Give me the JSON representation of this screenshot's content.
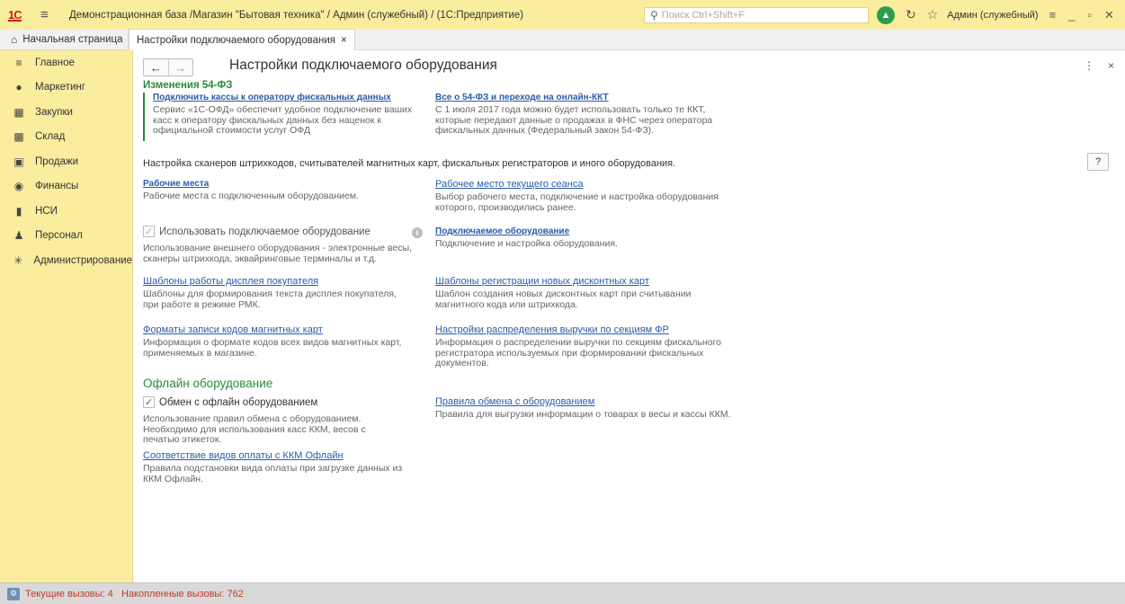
{
  "window": {
    "logo": "1С",
    "title": "Демонстрационная база /Магазин \"Бытовая техника\" / Админ (служебный) /  (1С:Предприятие)",
    "search_placeholder": "Поиск Ctrl+Shift+F",
    "user": "Админ (служебный)"
  },
  "tabs": {
    "home": "Начальная страница",
    "active": "Настройки подключаемого оборудования",
    "close_glyph": "×"
  },
  "sidebar": {
    "items": [
      {
        "label": "Главное",
        "icon": "menu-lines-icon"
      },
      {
        "label": "Маркетинг",
        "icon": "marketing-icon"
      },
      {
        "label": "Закупки",
        "icon": "purchases-icon"
      },
      {
        "label": "Склад",
        "icon": "warehouse-icon"
      },
      {
        "label": "Продажи",
        "icon": "sales-icon"
      },
      {
        "label": "Финансы",
        "icon": "finance-icon"
      },
      {
        "label": "НСИ",
        "icon": "reference-icon"
      },
      {
        "label": "Персонал",
        "icon": "person-icon"
      },
      {
        "label": "Администрирование",
        "icon": "gear-icon"
      }
    ]
  },
  "page": {
    "title": "Настройки подключаемого оборудования",
    "fz_heading": "Изменения 54-ФЗ",
    "fz_left_link": "Подключить кассы к оператору фискальных данных",
    "fz_left_desc": "Сервис «1С-ОФД» обеспечит удобное подключение ваших касс к оператору фискальных данных без наценок к официальной стоимости услуг ОФД",
    "fz_right_link": "Все о 54-ФЗ и переходе на онлайн-ККТ",
    "fz_right_desc": "С 1 июля 2017 года можно будет использовать только те ККТ, которые передают данные о продажах в ФНС через оператора фискальных данных (Федеральный закон 54-ФЗ).",
    "intro": "Настройка сканеров штрихкодов, считывателей магнитных карт, фискальных регистраторов и иного оборудования.",
    "help_label": "?",
    "workplaces_link": "Рабочие места",
    "workplaces_desc": "Рабочие места с подключенным оборудованием.",
    "current_wp_link": "Рабочее место текущего сеанса",
    "current_wp_desc": "Выбор рабочего места, подключение и настройка оборудования которого, производились ранее.",
    "use_equipment_label": "Использовать подключаемое оборудование",
    "use_equipment_desc": "Использование внешнего оборудования - электронные весы, сканеры штрихкода, эквайринговые терминалы и т.д.",
    "connected_link": "Подключаемое оборудование",
    "connected_desc": "Подключение и настройка оборудования.",
    "display_templates_link": "Шаблоны работы дисплея покупателя",
    "display_templates_desc": "Шаблоны для формирования текста дисплея покупателя, при работе в режиме РМК.",
    "discount_templates_link": "Шаблоны регистрации новых дисконтных карт",
    "discount_templates_desc": "Шаблон создания новых дисконтных карт при считывании магнитного кода или штрихкода.",
    "magnetic_formats_link": "Форматы записи кодов магнитных карт",
    "magnetic_formats_desc": "Информация о формате кодов всех видов магнитных карт, применяемых в магазине.",
    "revenue_link": "Настройки распределения выручки по секциям ФР",
    "revenue_desc": "Информация о распределении выручки по секциям фискального регистратора используемых при формировании фискальных документов.",
    "offline_heading": "Офлайн оборудование",
    "offline_exchange_label": "Обмен с офлайн оборудованием",
    "offline_exchange_desc": "Использование правил обмена с оборудованием. Необходимо для использования касс ККМ, весов с печатью этикеток.",
    "exchange_rules_link": "Правила обмена с оборудованием",
    "exchange_rules_desc": "Правила для выгрузки информации о товарах в весы и кассы ККМ.",
    "payment_types_link": "Соответствие видов оплаты с ККМ Офлайн",
    "payment_types_desc": "Правила подстановки вида оплаты при загрузке данных из ККМ Офлайн."
  },
  "status": {
    "text": "Текущие вызовы: 4   Накопленные вызовы: 762"
  },
  "colors": {
    "accent_yellow": "#fbed9e",
    "green": "#2a8a3a",
    "link": "#2a5cab",
    "status_red": "#c0392b"
  }
}
